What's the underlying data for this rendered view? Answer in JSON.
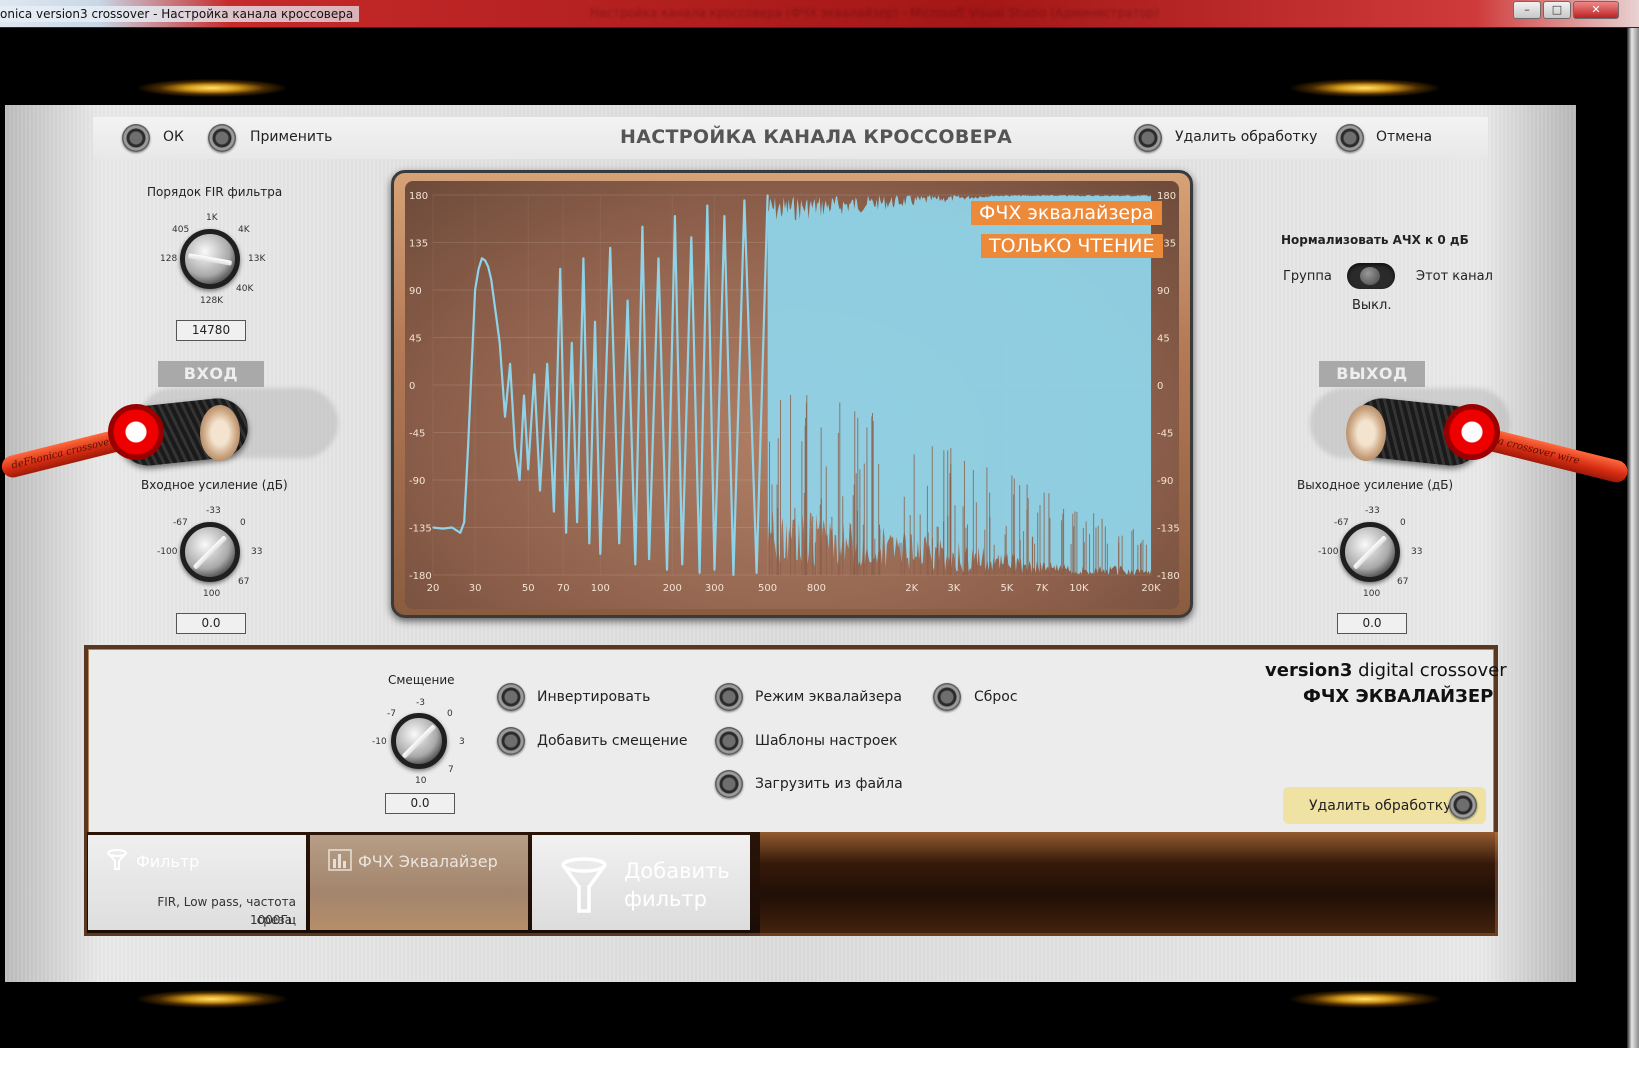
{
  "window": {
    "title": "onica version3 crossover - Настройка канала кроссовера",
    "background_title": "Настройка канала кроссовера (ФЧХ эквалайзер) - Microsoft Visual Studio (Администратор)",
    "buttons": {
      "minimize": "–",
      "maximize": "□",
      "close": "✕"
    }
  },
  "toolbar": {
    "ok": "ОК",
    "apply": "Применить",
    "title": "НАСТРОЙКА КАНАЛА КРОССОВЕРА",
    "remove": "Удалить обработку",
    "cancel": "Отмена"
  },
  "fir": {
    "label": "Порядок FIR фильтра",
    "ticks": [
      "1K",
      "4K",
      "405",
      "128",
      "13K",
      "40K",
      "128K"
    ],
    "value": "14780"
  },
  "input": {
    "badge": "ВХОД",
    "gain_label": "Входное усиление (дБ)",
    "ticks": [
      "-33",
      "0",
      "-67",
      "-100",
      "33",
      "67",
      "100"
    ],
    "value": "0.0",
    "cable_text": "deFhonica crossover wire"
  },
  "output": {
    "badge": "ВЫХОД",
    "gain_label": "Выходное усиление (дБ)",
    "ticks": [
      "-33",
      "0",
      "-67",
      "-100",
      "33",
      "67",
      "100"
    ],
    "value": "0.0",
    "cable_text": "dePhonica crossover wire"
  },
  "normalize": {
    "title": "Нормализовать АЧХ к 0 дБ",
    "left": "Группа",
    "right": "Этот канал",
    "state": "Выкл."
  },
  "plot": {
    "tag1": "ФЧХ эквалайзера",
    "tag2": "ТОЛЬКО ЧТЕНИЕ",
    "fill_color": "#8fd3e8"
  },
  "chart_data": {
    "type": "line",
    "x_axis": {
      "scale": "log",
      "ticks": [
        "20",
        "30",
        "50",
        "70",
        "100",
        "200",
        "300",
        "500",
        "800",
        "2K",
        "3K",
        "5K",
        "7K",
        "10K",
        "20K"
      ]
    },
    "y_axis": {
      "ticks": [
        "180",
        "135",
        "90",
        "45",
        "0",
        "-45",
        "-90",
        "-135",
        "-180"
      ],
      "ylim": [
        -180,
        180
      ]
    },
    "series": [
      {
        "x": [
          20,
          22,
          24,
          26,
          27,
          28,
          30,
          31,
          32,
          33,
          34,
          35,
          37,
          38,
          40,
          42,
          44,
          46,
          48,
          50,
          53,
          56,
          60,
          64,
          68,
          72,
          76,
          80,
          85,
          90,
          95,
          100,
          110,
          120,
          130,
          140,
          150,
          160,
          175,
          190,
          205,
          220,
          240,
          260,
          280,
          300,
          330,
          360,
          400,
          450,
          500
        ],
        "y": [
          -135,
          -136,
          -135,
          -140,
          -130,
          -60,
          90,
          110,
          120,
          118,
          112,
          100,
          60,
          40,
          -30,
          20,
          -60,
          -90,
          -10,
          -80,
          10,
          -100,
          20,
          -120,
          110,
          -140,
          40,
          -130,
          120,
          -150,
          60,
          -160,
          130,
          -150,
          80,
          -170,
          150,
          -165,
          120,
          -175,
          160,
          -170,
          140,
          -178,
          170,
          -175,
          160,
          -180,
          175,
          -178,
          180
        ]
      }
    ]
  },
  "editor": {
    "shift_label": "Смещение",
    "shift_ticks": [
      "-3",
      "0",
      "-7",
      "-10",
      "3",
      "7",
      "10"
    ],
    "shift_value": "0.0",
    "invert": "Инвертировать",
    "add_shift": "Добавить смещение",
    "eq_mode": "Режим эквалайзера",
    "presets": "Шаблоны настроек",
    "load_file": "Загрузить из файла",
    "reset": "Сброс",
    "brand_bold": "version3",
    "brand_rest": " digital crossover",
    "brand_sub": "ФЧХ ЭКВАЛАЙЗЕР",
    "remove": "Удалить обработку"
  },
  "tabs": [
    {
      "title": "Фильтр",
      "desc1": "FIR, Low pass, частота среза:",
      "desc2": "1000Гц"
    },
    {
      "title": "ФЧХ Эквалайзер"
    },
    {
      "title1": "Добавить",
      "title2": "фильтр"
    }
  ]
}
